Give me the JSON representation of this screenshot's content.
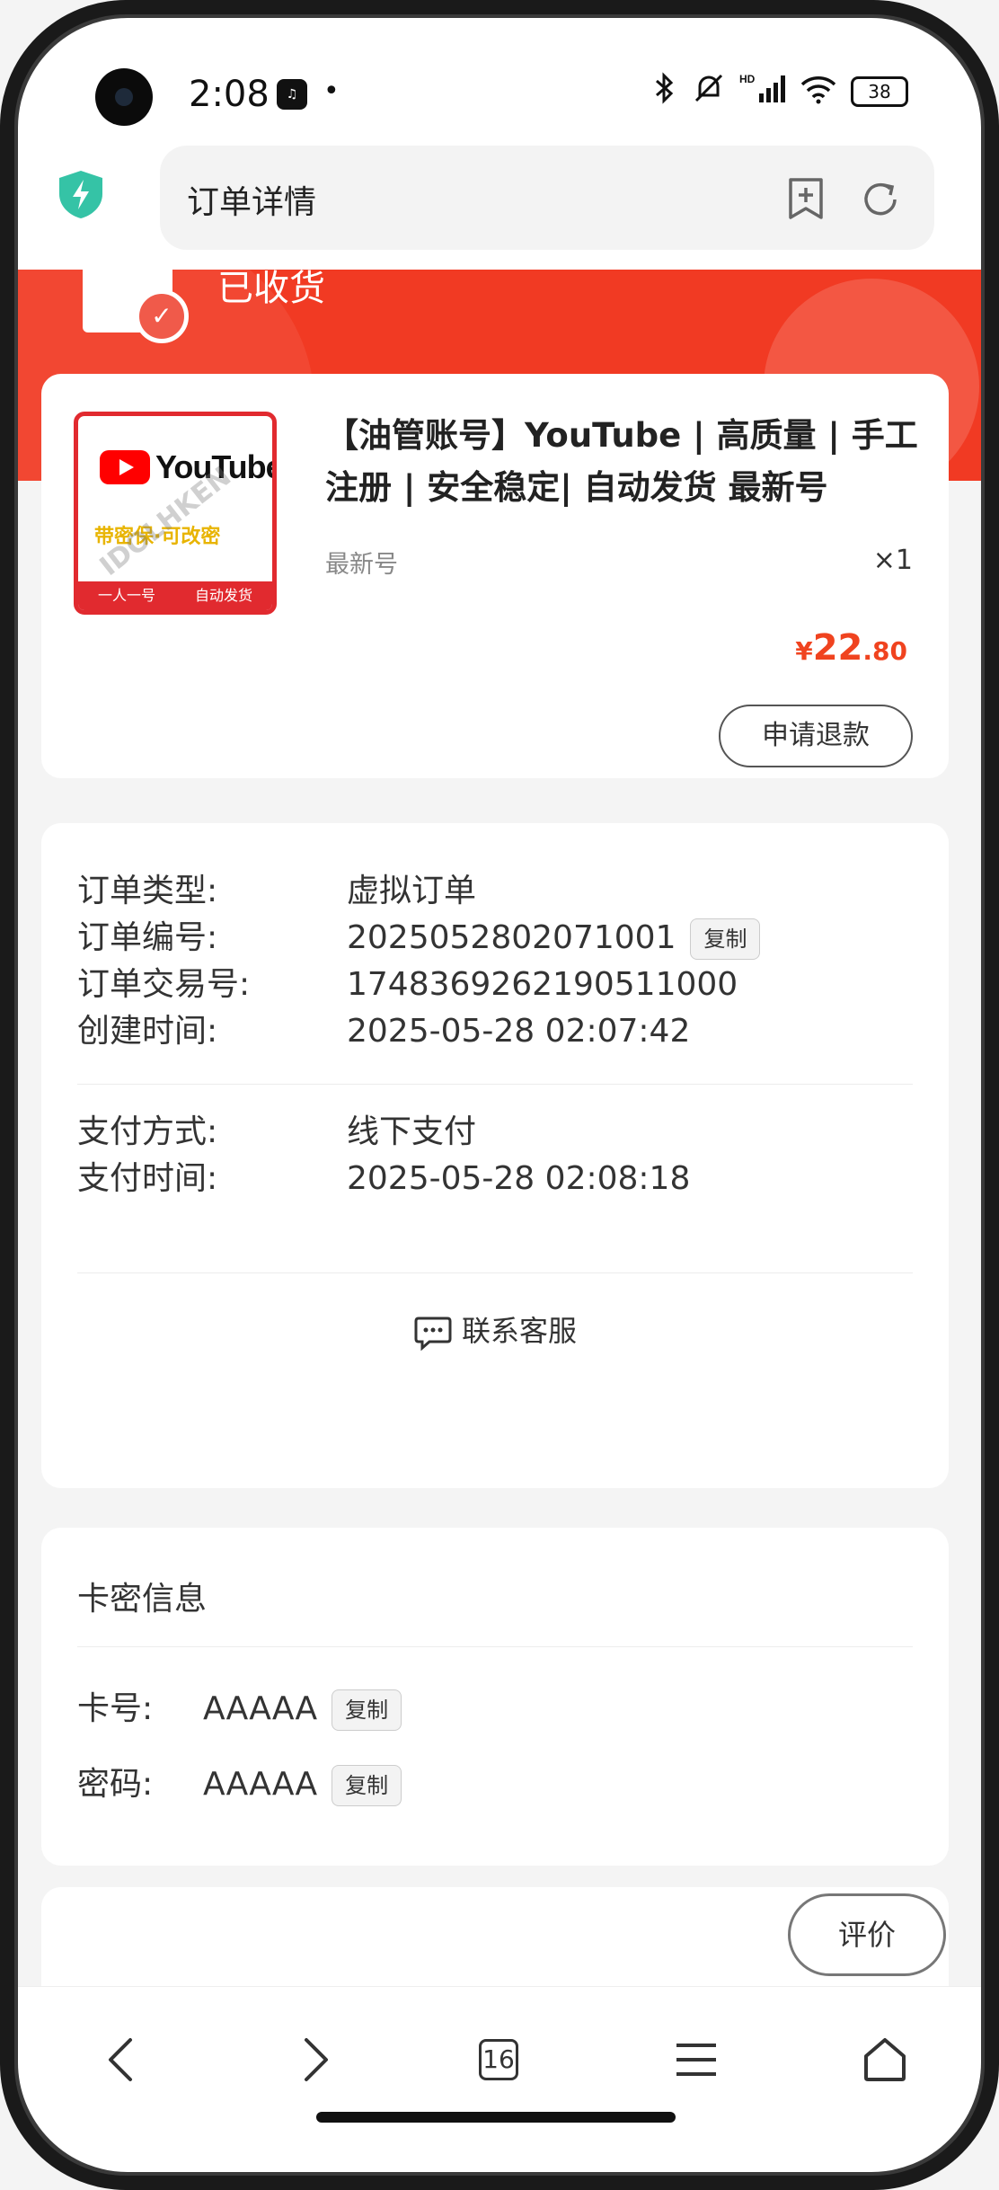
{
  "status_bar": {
    "time": "2:08",
    "battery": "38",
    "network": "HD"
  },
  "browser": {
    "page_title": "订单详情"
  },
  "order_status": {
    "label": "已收货"
  },
  "product": {
    "title": "【油管账号】YouTube | 高质量 | 手工注册 | 安全稳定| 自动发货 最新号",
    "spec": "最新号",
    "quantity": "×1",
    "price_symbol": "¥",
    "price_integer": "22",
    "price_decimal": ".80",
    "refund_label": "申请退款",
    "thumb": {
      "brand": "YouTube",
      "middle_text": "带密保·可改密",
      "bottom_left": "一人一号",
      "bottom_right": "自动发货",
      "watermark": "IDOLHKEN"
    }
  },
  "order_info": {
    "type_label": "订单类型:",
    "type_value": "虚拟订单",
    "number_label": "订单编号:",
    "number_value": "2025052802071001",
    "copy_label": "复制",
    "trade_label": "订单交易号:",
    "trade_value": "1748369262190511000",
    "created_label": "创建时间:",
    "created_value": "2025-05-28 02:07:42",
    "pay_method_label": "支付方式:",
    "pay_method_value": "线下支付",
    "pay_time_label": "支付时间:",
    "pay_time_value": "2025-05-28 02:08:18",
    "contact_label": "联系客服"
  },
  "card_info": {
    "section_title": "卡密信息",
    "card_no_label": "卡号:",
    "card_no_value": "AAAAA",
    "password_label": "密码:",
    "password_value": "AAAAA",
    "copy_label": "复制"
  },
  "review": {
    "label": "评价"
  },
  "bottom_nav": {
    "tab_count": "16"
  },
  "colors": {
    "accent_red": "#f13a23",
    "price_red": "#f0431f"
  }
}
